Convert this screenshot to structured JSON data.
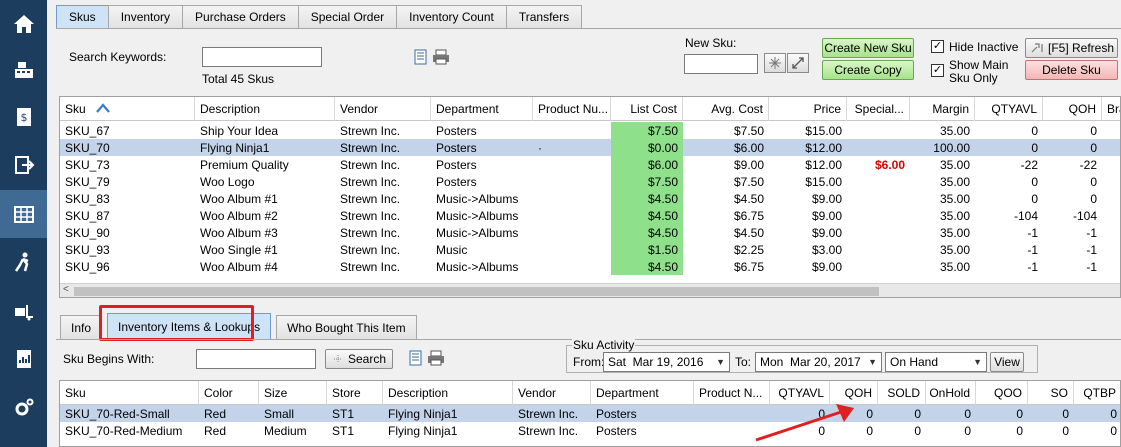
{
  "nav": [
    "home-icon",
    "register-icon",
    "receipt-icon",
    "logout-icon",
    "inventory-icon",
    "customer-icon",
    "shipping-icon",
    "reports-icon",
    "settings-icon"
  ],
  "tabs_top": [
    "Skus",
    "Inventory",
    "Purchase Orders",
    "Special Order",
    "Inventory Count",
    "Transfers"
  ],
  "search": {
    "label": "Search Keywords:",
    "value": "",
    "total": "Total 45 Skus"
  },
  "new_sku": {
    "label": "New Sku:",
    "value": ""
  },
  "buttons": {
    "create_new_sku": "Create New Sku",
    "create_copy": "Create Copy",
    "refresh": "[F5] Refresh",
    "delete_sku": "Delete Sku"
  },
  "checks": {
    "hide_inactive": "Hide Inactive",
    "show_main_1": "Show Main",
    "show_main_2": "Sku Only"
  },
  "sku_grid": {
    "headers": [
      "Sku",
      "Description",
      "Vendor",
      "Department",
      "Product Nu...",
      "List Cost",
      "Avg. Cost",
      "Price",
      "Special...",
      "Margin",
      "QTYAVL",
      "QOH",
      "Bran"
    ],
    "rows": [
      [
        "SKU_67",
        "Ship Your Idea",
        "Strewn Inc.",
        "Posters",
        "",
        "$7.50",
        "$7.50",
        "$15.00",
        "",
        "35.00",
        "0",
        "0",
        ""
      ],
      [
        "SKU_70",
        "Flying Ninja1",
        "Strewn Inc.",
        "Posters",
        "·",
        "$0.00",
        "$6.00",
        "$12.00",
        "",
        "100.00",
        "0",
        "0",
        ""
      ],
      [
        "SKU_73",
        "Premium Quality",
        "Strewn Inc.",
        "Posters",
        "",
        "$6.00",
        "$9.00",
        "$12.00",
        "$6.00",
        "35.00",
        "-22",
        "-22",
        ""
      ],
      [
        "SKU_79",
        "Woo Logo",
        "Strewn Inc.",
        "Posters",
        "",
        "$7.50",
        "$7.50",
        "$15.00",
        "",
        "35.00",
        "0",
        "0",
        ""
      ],
      [
        "SKU_83",
        "Woo Album #1",
        "Strewn Inc.",
        "Music->Albums",
        "",
        "$4.50",
        "$4.50",
        "$9.00",
        "",
        "35.00",
        "0",
        "0",
        ""
      ],
      [
        "SKU_87",
        "Woo Album #2",
        "Strewn Inc.",
        "Music->Albums",
        "",
        "$4.50",
        "$6.75",
        "$9.00",
        "",
        "35.00",
        "-104",
        "-104",
        ""
      ],
      [
        "SKU_90",
        "Woo Album #3",
        "Strewn Inc.",
        "Music->Albums",
        "",
        "$4.50",
        "$4.50",
        "$9.00",
        "",
        "35.00",
        "-1",
        "-1",
        ""
      ],
      [
        "SKU_93",
        "Woo Single #1",
        "Strewn Inc.",
        "Music",
        "",
        "$1.50",
        "$2.25",
        "$3.00",
        "",
        "35.00",
        "-1",
        "-1",
        ""
      ],
      [
        "SKU_96",
        "Woo Album #4",
        "Strewn Inc.",
        "Music->Albums",
        "",
        "$4.50",
        "$6.75",
        "$9.00",
        "",
        "35.00",
        "-1",
        "-1",
        ""
      ]
    ]
  },
  "tabs_bottom": [
    "Info",
    "Inventory Items & Lookups",
    "Who Bought This Item"
  ],
  "sku_begins": {
    "label": "Sku Begins With:",
    "value": "",
    "search_button": "Search"
  },
  "activity": {
    "title": "Sku Activity",
    "from_label": "From:",
    "from_value": "Sat  Mar 19, 2016",
    "to_label": "To:",
    "to_value": "Mon  Mar 20, 2017",
    "mode": "On Hand",
    "view_button": "View"
  },
  "items_grid": {
    "headers": [
      "Sku",
      "Color",
      "Size",
      "Store",
      "Description",
      "Vendor",
      "Department",
      "Product N...",
      "QTYAVL",
      "QOH",
      "SOLD",
      "OnHold",
      "QOO",
      "SO",
      "QTBP"
    ],
    "rows": [
      [
        "SKU_70-Red-Small",
        "Red",
        "Small",
        "ST1",
        "Flying Ninja1",
        "Strewn Inc.",
        "Posters",
        "",
        "0",
        "0",
        "0",
        "0",
        "0",
        "0",
        "0"
      ],
      [
        "SKU_70-Red-Medium",
        "Red",
        "Medium",
        "ST1",
        "Flying Ninja1",
        "Strewn Inc.",
        "Posters",
        "",
        "0",
        "0",
        "0",
        "0",
        "0",
        "0",
        "0"
      ]
    ]
  },
  "colors": {
    "nav_bg": "#1d3d5e",
    "selected_row": "#c3d4ea",
    "list_cost_green": "#8ee08a",
    "special_red": "#e00000",
    "highlight_red": "#e02020"
  }
}
